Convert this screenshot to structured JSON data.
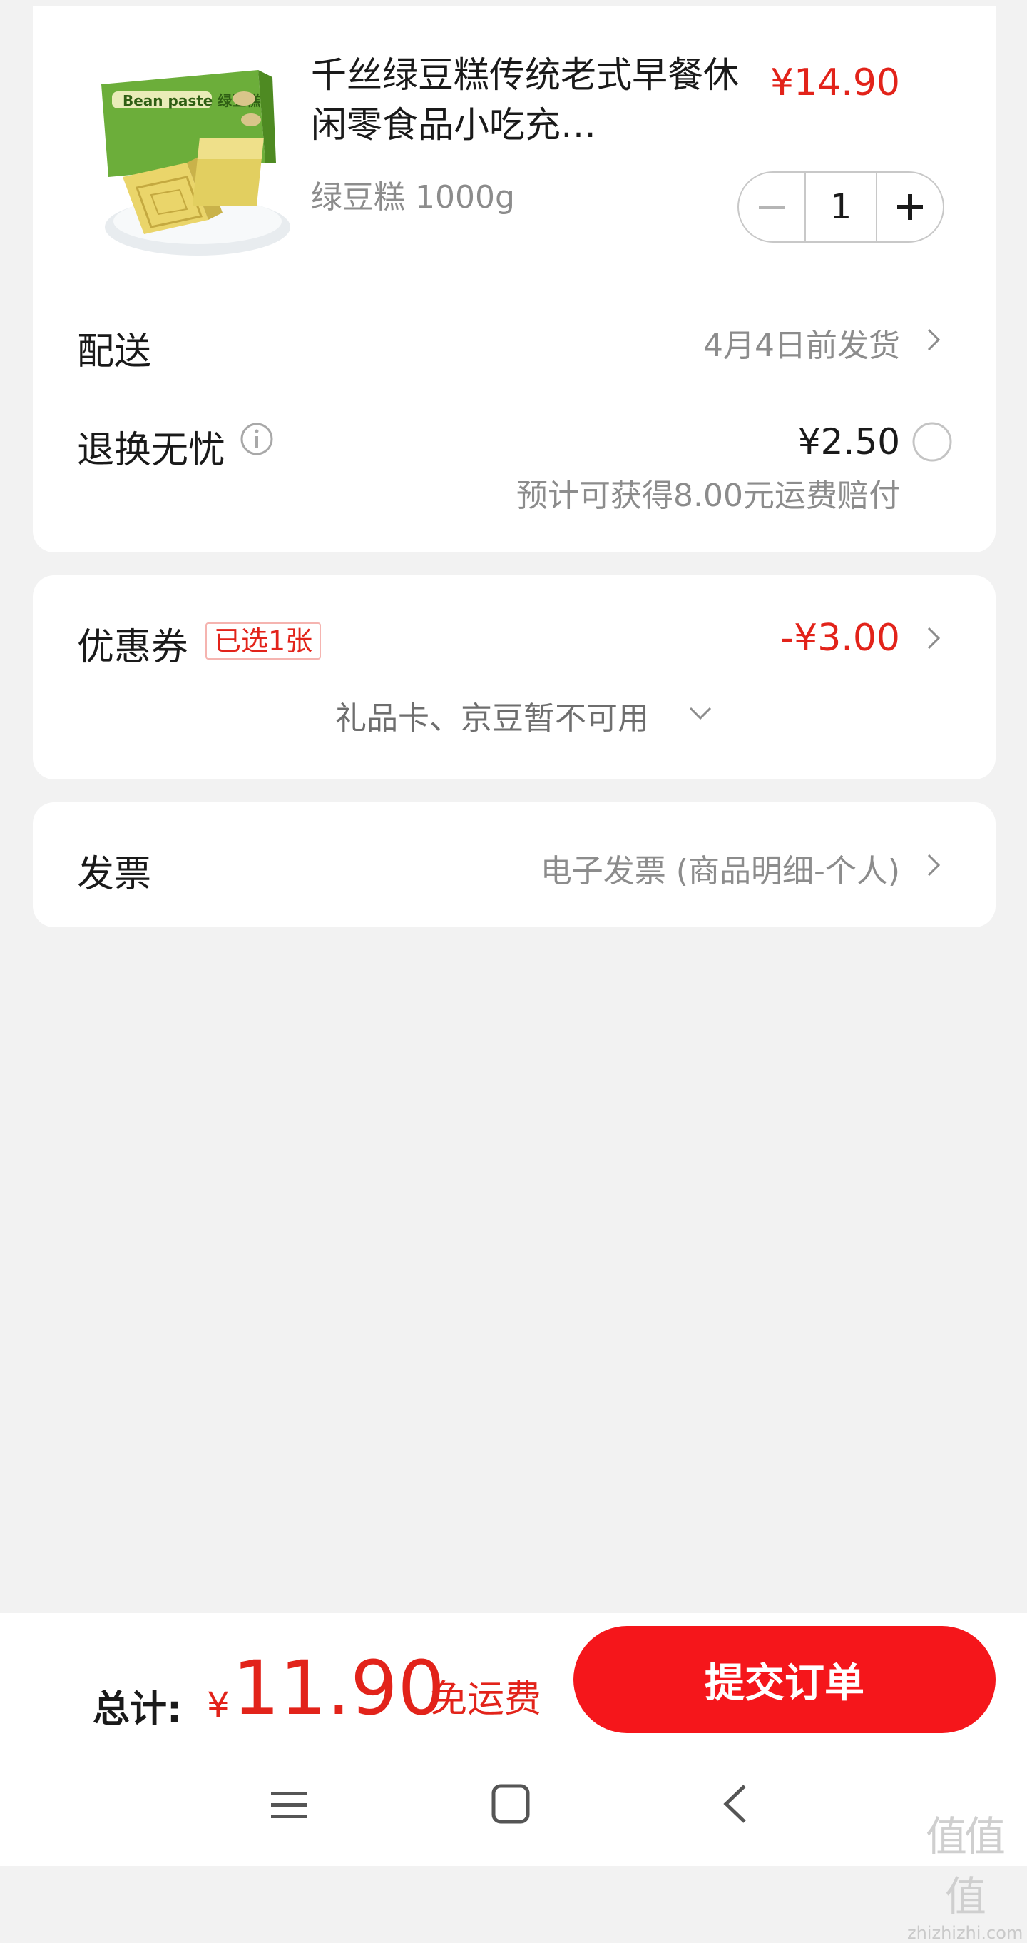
{
  "product": {
    "title": "千丝绿豆糕传统老式早餐休闲零食品小吃充…",
    "image_text": "Bean paste 绿豆糕",
    "spec": "绿豆糕 1000g",
    "price": "¥14.90",
    "quantity": "1"
  },
  "delivery": {
    "label": "配送",
    "value": "4月4日前发货"
  },
  "return_guarantee": {
    "label": "退换无忧",
    "price": "¥2.50",
    "note": "预计可获得8.00元运费赔付"
  },
  "coupon": {
    "label": "优惠券",
    "tag": "已选1张",
    "value": "-¥3.00",
    "sub_note": "礼品卡、京豆暂不可用"
  },
  "invoice": {
    "label": "发票",
    "value": "电子发票 (商品明细-个人)"
  },
  "bottom": {
    "total_label": "总计:",
    "currency": "¥",
    "total_amount": "11.90",
    "shipping": "免运费",
    "submit_label": "提交订单"
  },
  "watermark": {
    "big": "值值值",
    "small": "zhizhizhi.com"
  },
  "colors": {
    "accent": "#e2231a",
    "button": "#f5161b",
    "background": "#f2f2f2"
  },
  "icons": [
    "minus-icon",
    "plus-icon",
    "chevron-right-icon",
    "info-icon",
    "radio-icon",
    "chevron-down-icon",
    "menu-icon",
    "home-icon",
    "back-icon"
  ]
}
